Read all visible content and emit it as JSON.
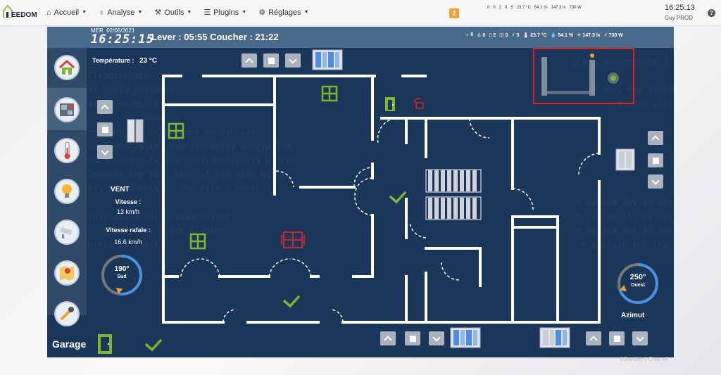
{
  "app": {
    "logo_text": "EEDOM"
  },
  "nav": {
    "items": [
      {
        "label": "Accueil",
        "icon": "home-icon"
      },
      {
        "label": "Analyse",
        "icon": "stethoscope-icon"
      },
      {
        "label": "Outils",
        "icon": "wrench-icon"
      },
      {
        "label": "Plugins",
        "icon": "list-icon"
      },
      {
        "label": "Réglages",
        "icon": "gear-icon"
      }
    ],
    "notification_count": "2"
  },
  "top_status": [
    "0",
    "0",
    "2",
    "0",
    "5",
    "23.7 °C",
    "54.1 %",
    "147.3 lx",
    "730 W"
  ],
  "top_right": {
    "time": "16:25:13",
    "user": "Guy PROD"
  },
  "panel": {
    "date": "MER. 02/06/2021",
    "clock": "16:25:15",
    "sun": "Lever : 05:55 Coucher : 21:22",
    "status": [
      "0",
      "0",
      "2",
      "0",
      "5",
      "23.7 °C",
      "54.1 %",
      "147.3 lx",
      "730 W"
    ],
    "temperature_label": "Température :",
    "temperature_value": "23 °C",
    "wind": {
      "title": "VENT",
      "speed_label": "Vitesse :",
      "speed_value": "13 km/h",
      "gust_label": "Vitesse rafale :",
      "gust_value": "16.6 km/h",
      "direction_deg": "190°",
      "direction_name": "Sud",
      "direction_value": 190
    },
    "azimut": {
      "deg": "250°",
      "name": "Ouest",
      "label": "Azimut",
      "value": 250
    },
    "garage_label": "Garage"
  },
  "sidebar": [
    "house-icon",
    "floorplan-icon",
    "thermometer-icon",
    "bulb-icon",
    "camera-icon",
    "map-icon",
    "tool-icon"
  ],
  "watermark": "©Jeedom | Core v4",
  "colors": {
    "panel_bg": "#1a3658",
    "header": "#4a6a8c",
    "green": "#7ab82c",
    "red": "#d22",
    "accent_orange": "#f0a030"
  }
}
